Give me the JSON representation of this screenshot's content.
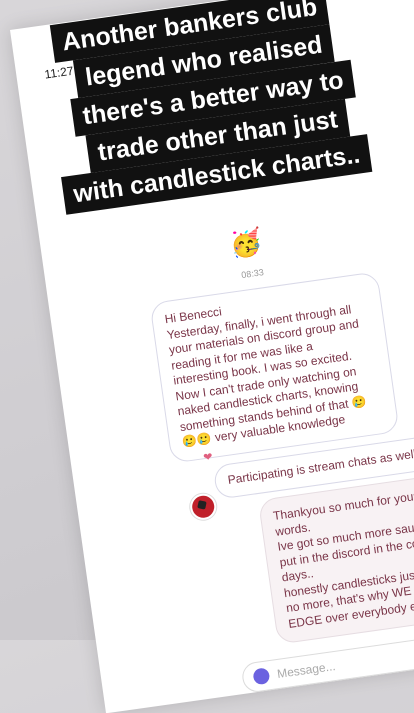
{
  "status_bar": {
    "time": "11:27",
    "location_icon": "location-arrow-icon"
  },
  "caption": {
    "lines": [
      "Another bankers club",
      "legend who realised",
      "there's a better way to",
      "trade other than just",
      "with candlestick charts.."
    ],
    "emoji": "🥳"
  },
  "chat": {
    "timestamp": "08:33",
    "incoming_message_lines": [
      "Hi Benecci",
      "Yesterday, finally, i went through all",
      "your materials on discord group and",
      "reading it for me was like a",
      "interesting book. I was so excited.",
      "Now I can't trade only watching on",
      "naked candlestick charts, knowing",
      "something stands behind of that 🥲",
      "🥲🥲 very valuable knowledge"
    ],
    "reaction": "❤",
    "stream_message": "Participating is stream chats as well.",
    "reply_message_lines": [
      "Thankyou so much for your kind",
      "words.",
      "Ive got so much more sauce I need to",
      "put in the discord in the coming",
      "days..",
      "honestly candlesticks just don't cut it",
      "no more, that's why WE HAVE AN",
      "EDGE over everybody else 👍"
    ]
  },
  "composer": {
    "placeholder": "Message..."
  },
  "tools": {
    "mic": "🎙",
    "gallery": "▦",
    "sticker": "☺"
  }
}
